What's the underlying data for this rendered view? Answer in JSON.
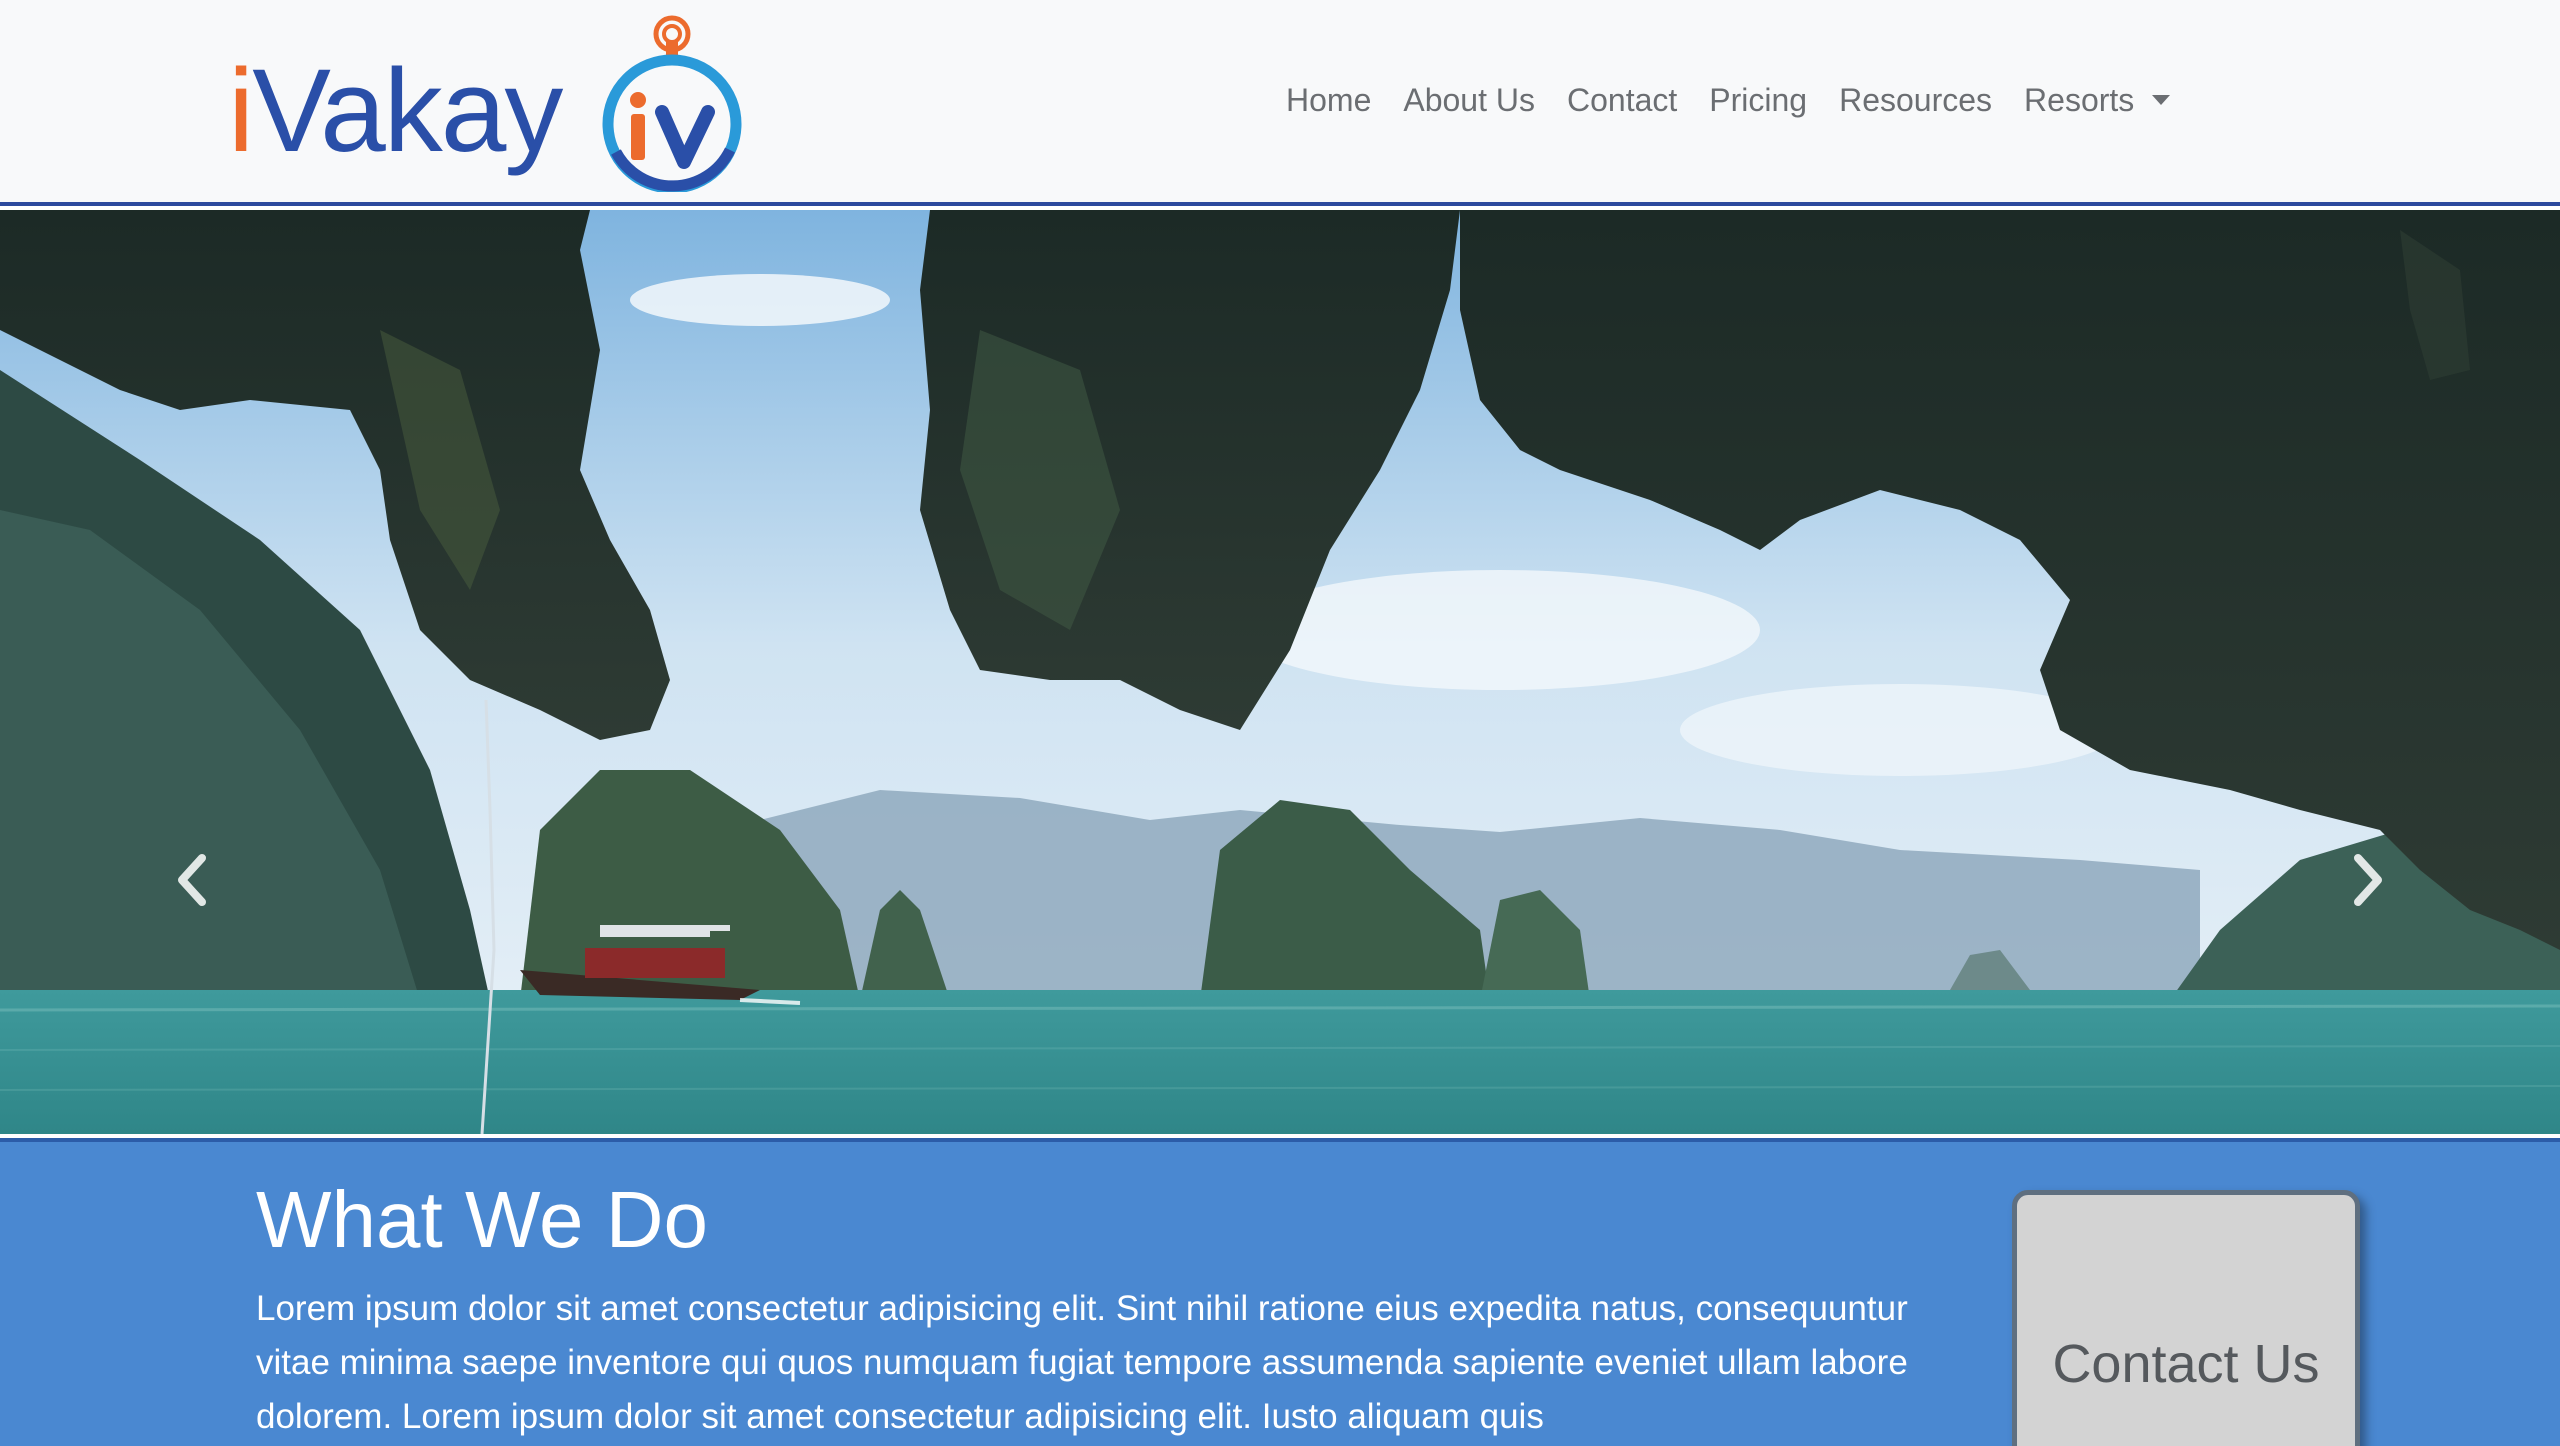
{
  "brand": {
    "logo_text": "iVakay",
    "logo_mark": "iv",
    "colors": {
      "blue": "#2a4fa8",
      "orange": "#ec6b2d",
      "cyan": "#2a9ad9"
    }
  },
  "nav": {
    "items": [
      "Home",
      "About Us",
      "Contact",
      "Pricing",
      "Resources"
    ],
    "dropdown_label": "Resorts"
  },
  "hero": {
    "image_subject": "sea cave overhang above turquoise bay with limestone islands and longtail boat",
    "prev_icon": "chevron-left-icon",
    "next_icon": "chevron-right-icon",
    "slide_count": 6,
    "active_slide": 1
  },
  "what_we_do": {
    "title": "What We Do",
    "body": "Lorem ipsum dolor sit amet consectetur adipisicing elit. Sint nihil ratione eius expedita natus, consequuntur vitae minima saepe inventore qui quos numquam fugiat tempore assumenda sapiente eveniet ullam labore dolorem. Lorem ipsum dolor sit amet consectetur adipisicing elit. Iusto aliquam quis"
  },
  "contact_card": {
    "label": "Contact Us"
  }
}
